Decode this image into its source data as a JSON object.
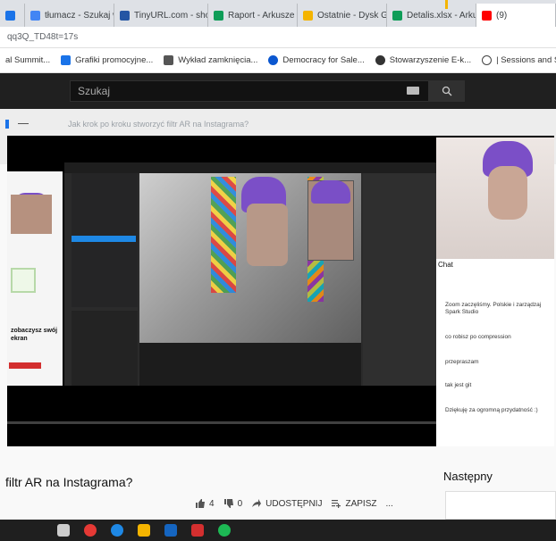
{
  "browser": {
    "tabs": [
      {
        "label": "",
        "color": "#1a73e8"
      },
      {
        "label": "tłumacz - Szukaj w",
        "color": "#4285f4"
      },
      {
        "label": "TinyURL.com - sho",
        "color": "#2455a4"
      },
      {
        "label": "Raport - Arkusze G",
        "color": "#0f9d58"
      },
      {
        "label": "Ostatnie - Dysk G",
        "color": "#f4b400"
      },
      {
        "label": "Detalis.xlsx - Arku",
        "color": "#0f9d58"
      },
      {
        "label": "(9)",
        "color": "#ff0000"
      }
    ],
    "address": "qq3Q_TD48t=17s",
    "bookmarks": [
      {
        "label": "al Summit...",
        "color": "#777777"
      },
      {
        "label": "Grafiki promocyjne...",
        "color": "#1a73e8"
      },
      {
        "label": "Wykład zamknięcia...",
        "color": "#555555"
      },
      {
        "label": "Democracy for Sale...",
        "color": "#0b57d0"
      },
      {
        "label": "Stowarzyszenie E-k...",
        "color": "#333333"
      },
      {
        "label": "| Sessions and Spea...",
        "color": "#444444"
      }
    ]
  },
  "youtube": {
    "search_placeholder": "Szukaj",
    "page_question": "Jak krok po kroku stworzyć filtr AR na Instagrama?",
    "video_title": "filtr AR na Instagrama?",
    "next_label": "Następny",
    "actions": {
      "likes": "4",
      "dislikes": "0",
      "share": "UDOSTĘPNIJ",
      "save": "ZAPISZ",
      "more": "..."
    },
    "progress_fraction": 0.0
  },
  "player": {
    "left_text": "zobaczysz swój ekran",
    "chat_header": "Chat",
    "chat_lines": [
      "Zoom zaczęliśmy. Polskie i zarządzaj Spark Studio",
      "co robisz po compression",
      "przepraszam",
      "tak jest git",
      "Dziękuję za ogromną przydatność :)"
    ]
  },
  "taskbar": {
    "icons": [
      "task-view-icon",
      "chrome-icon",
      "edge-icon",
      "file-explorer-icon",
      "store-icon",
      "app-icon",
      "spotify-icon"
    ],
    "colors": [
      "#cccccc",
      "#e53935",
      "#1e88e5",
      "#f4b400",
      "#1565c0",
      "#d32f2f",
      "#1db954"
    ]
  }
}
